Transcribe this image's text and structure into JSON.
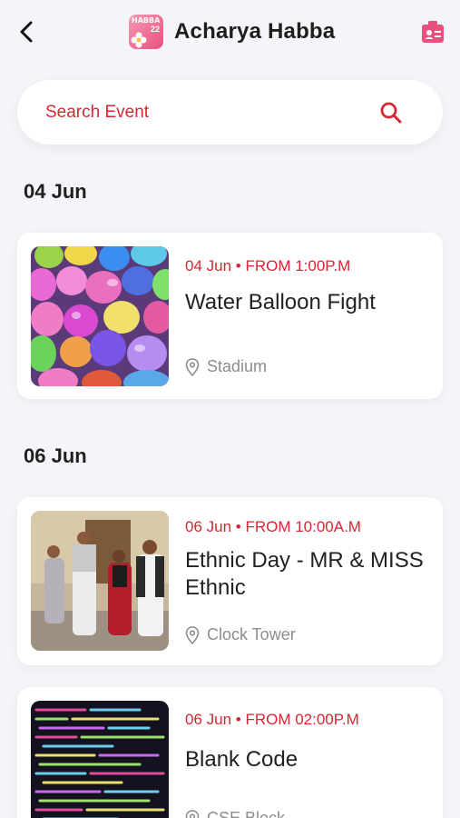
{
  "header": {
    "title": "Acharya Habba",
    "logo_text": "HABBA",
    "logo_num": "22"
  },
  "search": {
    "placeholder": "Search Event"
  },
  "colors": {
    "accent": "#d72631",
    "background": "#f3f5f8",
    "logo": "#e8507d"
  },
  "sections": [
    {
      "date": "04 Jun",
      "events": [
        {
          "time": "04 Jun • FROM 1:00P.M",
          "title": "Water Balloon Fight",
          "location": "Stadium"
        }
      ]
    },
    {
      "date": "06 Jun",
      "events": [
        {
          "time": "06 Jun • FROM 10:00A.M",
          "title": "Ethnic Day - MR & MISS Ethnic",
          "location": "Clock Tower"
        },
        {
          "time": "06 Jun • FROM 02:00P.M",
          "title": "Blank Code",
          "location": "CSE Block"
        }
      ]
    }
  ]
}
